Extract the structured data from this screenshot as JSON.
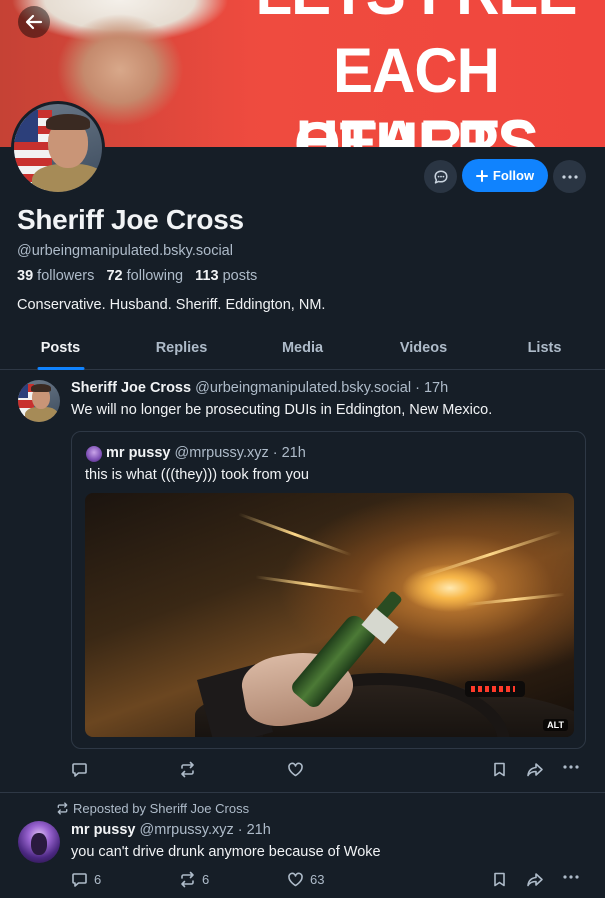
{
  "banner": {
    "text_line1": "LETS FREE",
    "text_line2": "EACH OTHERS",
    "text_line3": "HEARTS",
    "back_icon": "arrow-left-icon"
  },
  "profile": {
    "display_name": "Sheriff Joe Cross",
    "handle": "@urbeingmanipulated.bsky.social",
    "followers_count": "39",
    "followers_label": "followers",
    "following_count": "72",
    "following_label": "following",
    "posts_count": "113",
    "posts_label": "posts",
    "bio": "Conservative. Husband. Sheriff. Eddington, NM.",
    "follow_label": "Follow",
    "message_icon": "chat-bubble-icon",
    "more_icon": "ellipsis-icon"
  },
  "tabs": [
    {
      "label": "Posts",
      "active": true
    },
    {
      "label": "Replies",
      "active": false
    },
    {
      "label": "Media",
      "active": false
    },
    {
      "label": "Videos",
      "active": false
    },
    {
      "label": "Lists",
      "active": false
    }
  ],
  "posts": [
    {
      "author_name": "Sheriff Joe Cross",
      "author_handle": "@urbeingmanipulated.bsky.social",
      "time": "· 17h",
      "text": "We will no longer be prosecuting DUIs in Eddington, New Mexico.",
      "quote": {
        "author_name": "mr pussy",
        "author_handle": "@mrpussy.xyz",
        "time": "· 21h",
        "text": "this is what (((they))) took from you",
        "image_alt_badge": "ALT"
      },
      "reply_count": "",
      "repost_count": "",
      "like_count": ""
    },
    {
      "repost_by": "Reposted by Sheriff Joe Cross",
      "author_name": "mr pussy",
      "author_handle": "@mrpussy.xyz",
      "time": "· 21h",
      "text": "you can't drive drunk anymore because of Woke",
      "reply_count": "6",
      "repost_count": "6",
      "like_count": "63"
    }
  ],
  "colors": {
    "background": "#161e27",
    "accent": "#1083fe",
    "banner": "#ef4b3f",
    "muted_text": "#aebbc9"
  }
}
